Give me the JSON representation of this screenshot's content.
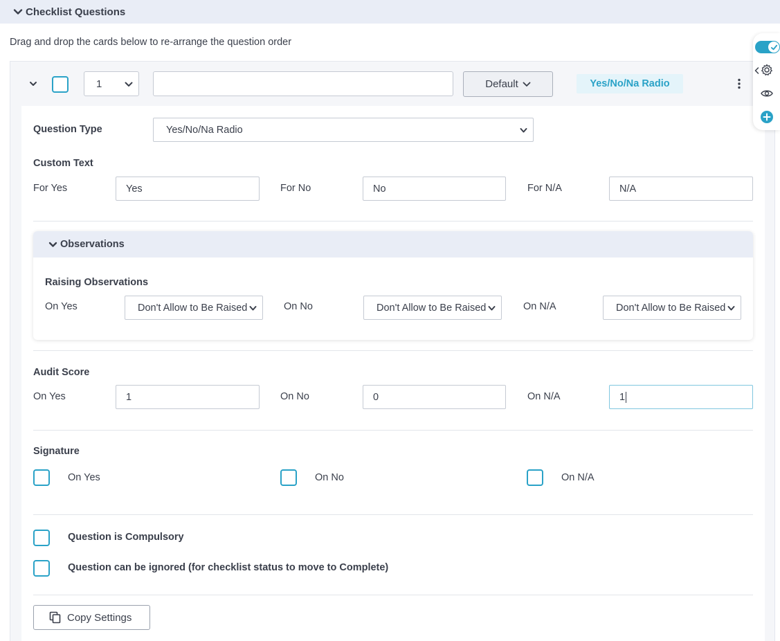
{
  "section": {
    "title": "Checklist Questions"
  },
  "hint": "Drag and drop the cards below to re-arrange the question order",
  "question": {
    "order_value": "1",
    "name_value": "",
    "default_label": "Default",
    "type_badge": "Yes/No/Na Radio"
  },
  "question_type": {
    "label": "Question Type",
    "value": "Yes/No/Na Radio"
  },
  "custom_text": {
    "heading": "Custom Text",
    "for_yes_label": "For Yes",
    "for_yes_value": "Yes",
    "for_no_label": "For No",
    "for_no_value": "No",
    "for_na_label": "For N/A",
    "for_na_value": "N/A"
  },
  "observations": {
    "title": "Observations",
    "heading": "Raising Observations",
    "on_yes_label": "On Yes",
    "on_yes_value": "Don't Allow to Be Raised",
    "on_no_label": "On No",
    "on_no_value": "Don't Allow to Be Raised",
    "on_na_label": "On N/A",
    "on_na_value": "Don't Allow to Be Raised"
  },
  "audit_score": {
    "heading": "Audit Score",
    "on_yes_label": "On Yes",
    "on_yes_value": "1",
    "on_no_label": "On No",
    "on_no_value": "0",
    "on_na_label": "On N/A",
    "on_na_value": "1"
  },
  "signature": {
    "heading": "Signature",
    "on_yes_label": "On Yes",
    "on_no_label": "On No",
    "on_na_label": "On N/A"
  },
  "options": {
    "compulsory_label": "Question is Compulsory",
    "ignored_label": "Question can be ignored (for checklist status to move to Complete)"
  },
  "copy_settings_label": "Copy Settings",
  "colors": {
    "accent": "#2aa2c7",
    "header_bg": "#e9edf6",
    "badge_bg": "#e4f4fa"
  },
  "icons": [
    "chevron-down-icon",
    "kebab-menu-icon",
    "toggle-icon",
    "gear-icon",
    "eye-icon",
    "plus-circle-icon",
    "copy-icon",
    "chevron-left-icon"
  ]
}
